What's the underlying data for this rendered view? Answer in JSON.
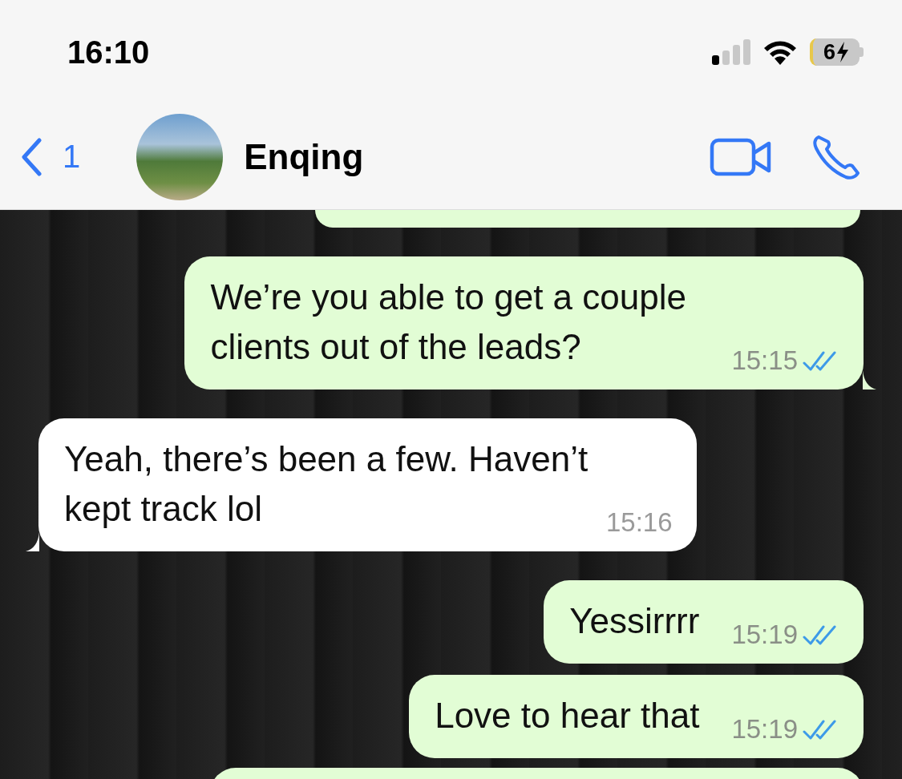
{
  "status_bar": {
    "time": "16:10",
    "battery": "6"
  },
  "header": {
    "back_count": "1",
    "contact_name": "Enqing"
  },
  "messages": [
    {
      "kind": "sent_cut_top"
    },
    {
      "kind": "sent",
      "text": "We’re you able to get a couple clients out of the leads?",
      "time": "15:15",
      "read": true
    },
    {
      "kind": "received",
      "text": "Yeah, there’s been a few. Haven’t kept track lol",
      "time": "15:16"
    },
    {
      "kind": "sent",
      "text": "Yessirrrr",
      "time": "15:19",
      "read": true
    },
    {
      "kind": "sent",
      "text": "Love to hear that",
      "time": "15:19",
      "read": true
    },
    {
      "kind": "sent_cut_bottom"
    }
  ]
}
